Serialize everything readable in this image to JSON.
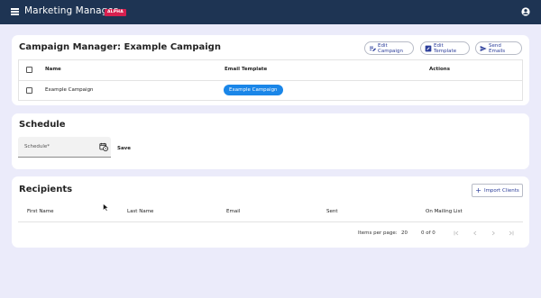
{
  "header": {
    "title": "Marketing Manager",
    "badge": "ALPHA"
  },
  "campaign": {
    "title": "Campaign Manager: Example Campaign",
    "buttons": {
      "edit_campaign": "Edit Campaign",
      "edit_template": "Edit Template",
      "send_emails": "Send Emails"
    },
    "columns": {
      "name": "Name",
      "email_template": "Email Template",
      "actions": "Actions"
    },
    "rows": [
      {
        "name": "Example Campaign",
        "email_template": "Example Campaign"
      }
    ]
  },
  "schedule": {
    "title": "Schedule",
    "field_label": "Schedule*",
    "save_label": "Save"
  },
  "recipients": {
    "title": "Recipients",
    "import_label": "Import Clients",
    "columns": {
      "first_name": "First Name",
      "last_name": "Last Name",
      "email": "Email",
      "sent": "Sent",
      "on_mailing_list": "On Mailing List"
    },
    "pagination": {
      "items_per_page_label": "Items per page:",
      "items_per_page": "20",
      "range": "0 of 0"
    }
  },
  "colors": {
    "topbar": "#1e3453",
    "badge": "#d6204f",
    "chip": "#1a86e8",
    "background": "#ebebfa",
    "accent": "#2b3d9a"
  }
}
